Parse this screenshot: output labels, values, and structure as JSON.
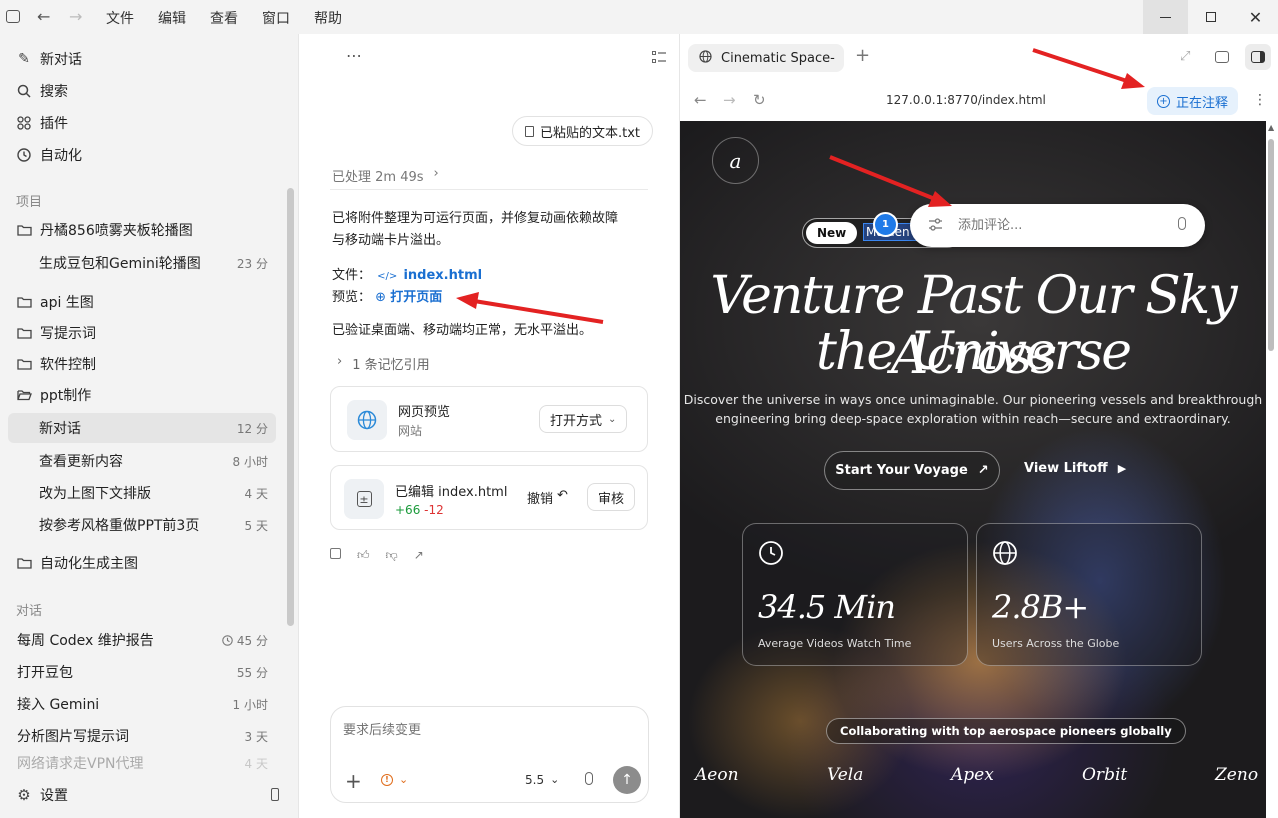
{
  "menu": [
    "文件",
    "编辑",
    "查看",
    "窗口",
    "帮助"
  ],
  "sidebar": {
    "top": [
      {
        "label": "新对话",
        "icon": "edit-icon"
      },
      {
        "label": "搜索",
        "icon": "search-icon"
      },
      {
        "label": "插件",
        "icon": "plugins-icon"
      },
      {
        "label": "自动化",
        "icon": "clock-icon"
      }
    ],
    "projects_label": "项目",
    "projects": [
      {
        "label": "丹橘856喷雾夹板轮播图",
        "type": "folder"
      },
      {
        "label": "生成豆包和Gemini轮播图",
        "time": "23 分",
        "type": "sub"
      },
      {
        "label": "api 生图",
        "type": "folder"
      },
      {
        "label": "写提示词",
        "type": "folder"
      },
      {
        "label": "软件控制",
        "type": "folder"
      },
      {
        "label": "ppt制作",
        "type": "folder-open"
      },
      {
        "label": "新对话",
        "time": "12 分",
        "type": "sub",
        "selected": true
      },
      {
        "label": "查看更新内容",
        "time": "8 小时",
        "type": "sub"
      },
      {
        "label": "改为上图下文排版",
        "time": "4 天",
        "type": "sub"
      },
      {
        "label": "按参考风格重做PPT前3页",
        "time": "5 天",
        "type": "sub"
      },
      {
        "label": "自动化生成主图",
        "type": "folder"
      }
    ],
    "chats_label": "对话",
    "chats": [
      {
        "label": "每周 Codex 维护报告",
        "time": "45 分",
        "clock": true
      },
      {
        "label": "打开豆包",
        "time": "55 分"
      },
      {
        "label": "接入 Gemini",
        "time": "1 小时"
      },
      {
        "label": "分析图片写提示词",
        "time": "3 天"
      },
      {
        "label": "网络请求走VPN代理",
        "time": "4 天"
      }
    ],
    "settings": "设置"
  },
  "chat": {
    "attachment": "已粘贴的文本.txt",
    "processed": "已处理 2m 49s",
    "message": "已将附件整理为可运行页面，并修复动画依赖故障与移动端卡片溢出。",
    "message_line1": "已将附件整理为可运行页面，并修复动画依赖故障",
    "message_line2": "与移动端卡片溢出。",
    "file_label": "文件：",
    "file_link": "index.html",
    "preview_label": "预览：",
    "preview_link": "打开页面",
    "verified": "已验证桌面端、移动端均正常，无水平溢出。",
    "memory": "1 条记忆引用",
    "web_card": {
      "title": "网页预览",
      "subtitle": "网站",
      "button": "打开方式"
    },
    "edit_card": {
      "title": "已编辑 index.html",
      "added": "+66",
      "removed": "-12",
      "undo": "撤销",
      "review": "审核"
    },
    "input_placeholder": "要求后续变更",
    "model": "5.5"
  },
  "browser": {
    "tab_title": "Cinematic Space-",
    "url": "127.0.0.1:8770/index.html",
    "annotating": "正在注释",
    "comment_placeholder": "添加评论...",
    "badge_number": "1",
    "site": {
      "logo": "a",
      "new_badge": "New",
      "pill_text": "Maiden Li",
      "title_line1": "Venture Past Our Sky Across",
      "title_line2": "the Universe",
      "desc_line1": "Discover the universe in ways once unimaginable. Our pioneering vessels and breakthrough",
      "desc_line2": "engineering bring deep-space exploration within reach—secure and extraordinary.",
      "cta_primary": "Start Your Voyage",
      "cta_secondary": "View Liftoff",
      "stats": [
        {
          "value": "34.5 Min",
          "label": "Average Videos Watch Time",
          "icon": "clock-icon"
        },
        {
          "value": "2.8B+",
          "label": "Users Across the Globe",
          "icon": "globe-icon"
        }
      ],
      "partners_label": "Collaborating with top aerospace pioneers globally",
      "partners": [
        "Aeon",
        "Vela",
        "Apex",
        "Orbit",
        "Zeno"
      ]
    }
  }
}
